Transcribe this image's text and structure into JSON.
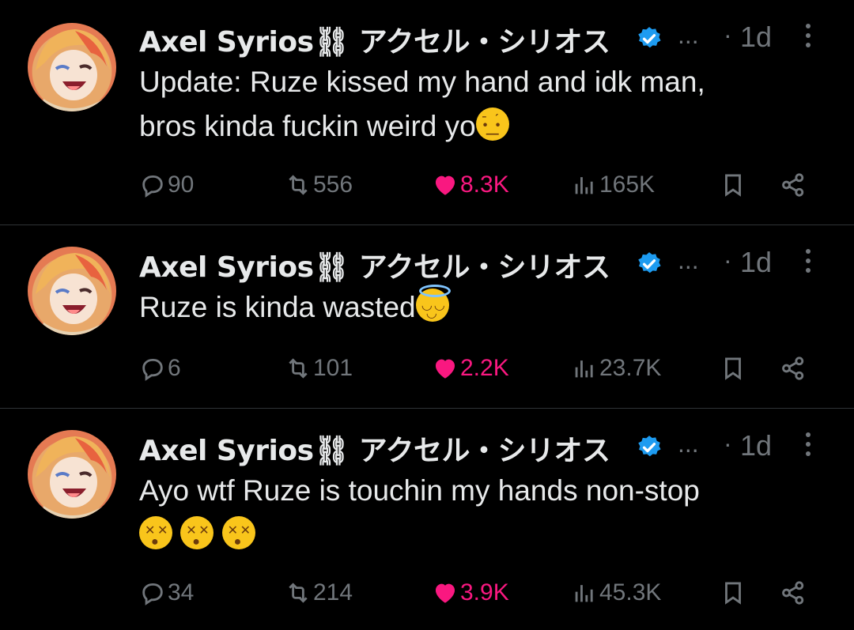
{
  "colors": {
    "background": "#000000",
    "text": "#e7e9ea",
    "muted": "#71767b",
    "like": "#f91880",
    "verified": "#1d9bf0",
    "divider": "#2f3336"
  },
  "tweets": [
    {
      "author": "Axel Syrios⛓ アクセル・シリオス",
      "handle_ellipsis": "...",
      "dot": "·",
      "time": "1d",
      "text_lines": [
        "Update: Ruze kissed my hand and idk man,",
        "bros kinda fuckin weird yo"
      ],
      "emojis": [
        "raised-eyebrow-emoji"
      ],
      "replies": "90",
      "reposts": "556",
      "likes": "8.3K",
      "views": "165K"
    },
    {
      "author": "Axel Syrios⛓ アクセル・シリオス",
      "handle_ellipsis": "...",
      "dot": "·",
      "time": "1d",
      "text_lines": [
        "Ruze is kinda wasted"
      ],
      "emojis": [
        "smiling-face-with-halo-emoji"
      ],
      "replies": "6",
      "reposts": "101",
      "likes": "2.2K",
      "views": "23.7K"
    },
    {
      "author": "Axel Syrios⛓ アクセル・シリオス",
      "handle_ellipsis": "...",
      "dot": "·",
      "time": "1d",
      "text_lines": [
        "Ayo wtf Ruze is touchin my hands non-stop",
        ""
      ],
      "emojis": [
        "dizzy-face-emoji",
        "dizzy-face-emoji",
        "dizzy-face-emoji"
      ],
      "replies": "34",
      "reposts": "214",
      "likes": "3.9K",
      "views": "45.3K"
    }
  ]
}
